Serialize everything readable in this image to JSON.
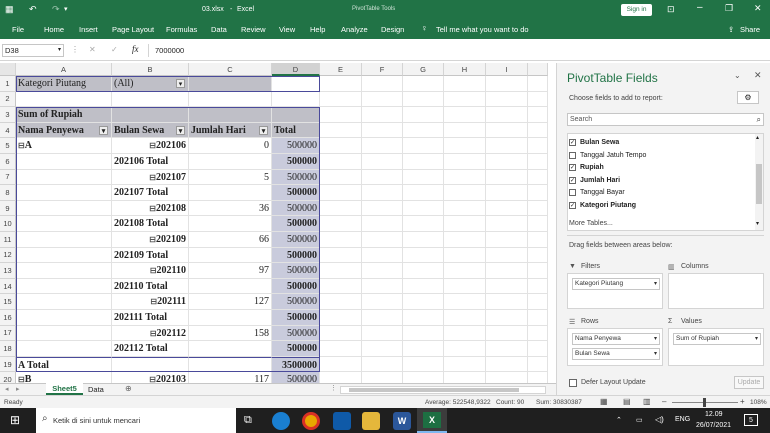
{
  "titlebar": {
    "filename": "03.xlsx",
    "app": "Excel",
    "context": "PivotTable Tools",
    "signin": "Sign in"
  },
  "ribbon": {
    "tabs": [
      "File",
      "Home",
      "Insert",
      "Page Layout",
      "Formulas",
      "Data",
      "Review",
      "View",
      "Help",
      "Analyze",
      "Design"
    ],
    "tellme": "Tell me what you want to do",
    "share": "Share"
  },
  "formula": {
    "namebox": "D38",
    "value": "7000000"
  },
  "columns": [
    "A",
    "B",
    "C",
    "D",
    "E",
    "F",
    "G",
    "H",
    "I"
  ],
  "rows": [
    {
      "n": "1",
      "a": "Kategori Piutang",
      "b": "(All)",
      "c": "",
      "d": ""
    },
    {
      "n": "2",
      "a": "",
      "b": "",
      "c": "",
      "d": ""
    },
    {
      "n": "3",
      "a": "Sum of Rupiah",
      "b": "",
      "c": "",
      "d": ""
    },
    {
      "n": "4",
      "a": "Nama Penyewa",
      "b": "Bulan Sewa",
      "c": "Jumlah Hari",
      "d": "Total"
    },
    {
      "n": "5",
      "a": "A",
      "b": "202106",
      "c": "0",
      "d": "500000"
    },
    {
      "n": "6",
      "a": "",
      "b": "202106 Total",
      "c": "",
      "d": "500000"
    },
    {
      "n": "7",
      "a": "",
      "b": "202107",
      "c": "5",
      "d": "500000"
    },
    {
      "n": "8",
      "a": "",
      "b": "202107 Total",
      "c": "",
      "d": "500000"
    },
    {
      "n": "9",
      "a": "",
      "b": "202108",
      "c": "36",
      "d": "500000"
    },
    {
      "n": "10",
      "a": "",
      "b": "202108 Total",
      "c": "",
      "d": "500000"
    },
    {
      "n": "11",
      "a": "",
      "b": "202109",
      "c": "66",
      "d": "500000"
    },
    {
      "n": "12",
      "a": "",
      "b": "202109 Total",
      "c": "",
      "d": "500000"
    },
    {
      "n": "13",
      "a": "",
      "b": "202110",
      "c": "97",
      "d": "500000"
    },
    {
      "n": "14",
      "a": "",
      "b": "202110 Total",
      "c": "",
      "d": "500000"
    },
    {
      "n": "15",
      "a": "",
      "b": "202111",
      "c": "127",
      "d": "500000"
    },
    {
      "n": "16",
      "a": "",
      "b": "202111 Total",
      "c": "",
      "d": "500000"
    },
    {
      "n": "17",
      "a": "",
      "b": "202112",
      "c": "158",
      "d": "500000"
    },
    {
      "n": "18",
      "a": "",
      "b": "202112 Total",
      "c": "",
      "d": "500000"
    },
    {
      "n": "19",
      "a": "A Total",
      "b": "",
      "c": "",
      "d": "3500000"
    },
    {
      "n": "20",
      "a": "B",
      "b": "202103",
      "c": "117",
      "d": "500000"
    }
  ],
  "sheets": [
    "Sheet5",
    "Data"
  ],
  "pane": {
    "title": "PivotTable Fields",
    "subtitle": "Choose fields to add to report:",
    "search": "Search",
    "fields": [
      {
        "label": "Bulan Sewa",
        "checked": "✓"
      },
      {
        "label": "Tanggal Jatuh Tempo",
        "checked": ""
      },
      {
        "label": "Rupiah",
        "checked": "✓"
      },
      {
        "label": "Jumlah Hari",
        "checked": "✓"
      },
      {
        "label": "Tanggal Bayar",
        "checked": ""
      },
      {
        "label": "Kategori Piutang",
        "checked": "✓"
      }
    ],
    "more": "More Tables...",
    "drag": "Drag fields between areas below:",
    "filters_label": "Filters",
    "columns_label": "Columns",
    "rows_label": "Rows",
    "values_label": "Values",
    "filter_chip": "Kategori Piutang",
    "row_chips": [
      "Nama Penyewa",
      "Bulan Sewa"
    ],
    "value_chip": "Sum of Rupiah",
    "defer": "Defer Layout Update",
    "update": "Update"
  },
  "status": {
    "ready": "Ready",
    "average": "Average: 522548,9322",
    "count": "Count: 90",
    "sum": "Sum: 30830387",
    "zoom": "108%"
  },
  "taskbar": {
    "search": "Ketik di sini untuk mencari",
    "lang": "ENG",
    "time": "12.09",
    "date": "26/07/2021",
    "badge": "5"
  }
}
